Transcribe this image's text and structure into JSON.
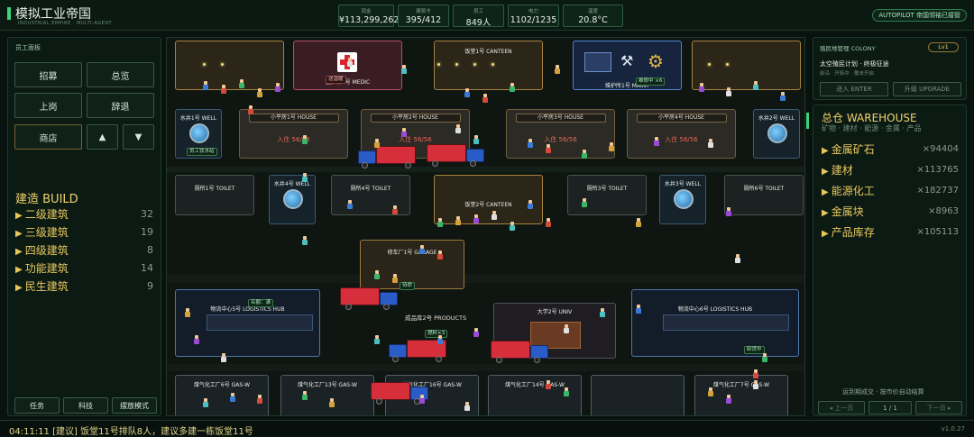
{
  "header": {
    "title": "模拟工业帝国",
    "subtitle": "INDUSTRIAL EMPIRE · MULTI-AGENT",
    "stats": [
      {
        "label": "现金",
        "value": "¥113,299,262"
      },
      {
        "label": "建筑令",
        "value": "395/412"
      },
      {
        "label": "员工",
        "value": "849人"
      },
      {
        "label": "电力",
        "value": "1102/1235"
      },
      {
        "label": "温度",
        "value": "20.8°C"
      }
    ],
    "autopilot": "AUTOPILOT 帝国领袖已接管"
  },
  "left": {
    "panel_title": "员工面板",
    "buttons": [
      "招募",
      "总览",
      "上岗",
      "辞退",
      "商店"
    ],
    "build_title": "建造 BUILD",
    "categories": [
      {
        "label": "二级建筑",
        "count": "32"
      },
      {
        "label": "三级建筑",
        "count": "19"
      },
      {
        "label": "四级建筑",
        "count": "8"
      },
      {
        "label": "功能建筑",
        "count": "14"
      },
      {
        "label": "民生建筑",
        "count": "9"
      }
    ],
    "bottom_buttons": [
      "任务",
      "科技",
      "摆放模式"
    ]
  },
  "right": {
    "colony_title": "殖民地管理 COLONY",
    "level": "Lv1",
    "plan": "太空殖民计划 · 终极征途",
    "plan_sub": "前沿 · 开拓中 · 敬未开启",
    "enter": "进入 ENTER",
    "upgrade": "升级 UPGRADE",
    "warehouse_title": "总仓 WAREHOUSE",
    "warehouse_sub": "矿物 · 建材 · 能源 · 金属 · 产品",
    "items": [
      {
        "label": "金属矿石",
        "count": "×94404"
      },
      {
        "label": "建材",
        "count": "×113765"
      },
      {
        "label": "能源化工",
        "count": "×182737"
      },
      {
        "label": "金属块",
        "count": "×8963"
      },
      {
        "label": "产品库存",
        "count": "×105113"
      }
    ],
    "auto_note": "运到期成交 · 按市价自动结算",
    "prev": "上一页",
    "page": "1 / 1",
    "next": "下一页"
  },
  "map": {
    "buildings": {
      "medic": "医护所1号 MEDIC",
      "canteen1": "饭堂1号 CANTEEN",
      "canteen2": "饭堂2号 CANTEEN",
      "maint": "维护所1号 MAINT",
      "house1": "小平房1号 HOUSE",
      "house2": "小平房2号 HOUSE",
      "house3": "小平房3号 HOUSE",
      "house4": "小平房4号 HOUSE",
      "house_status": "入住 56/56",
      "well1": "水井1号 WELL",
      "well2": "水井2号 WELL",
      "well3": "水井3号 WELL",
      "well4": "水井4号 WELL",
      "toilet1": "厕所1号 TOILET",
      "toilet3": "厕所3号 TOILET",
      "toilet4": "厕所4号 TOILET",
      "toilet6": "厕所6号 TOILET",
      "garage": "修车厂1号 GARAGE",
      "hub5": "物流中心5号 LOGISTICS HUB",
      "hub6": "物流中心6号 LOGISTICS HUB",
      "products": "成品库2号 PRODUCTS",
      "univ": "大学2号 UNIV",
      "gas6": "煤气化工厂6号 GAS-W",
      "gas13": "煤气化工厂13号 GAS-W",
      "gas16": "煤气化工厂16号 GAS-W",
      "gas14": "煤气化工厂14号 GAS-W",
      "gas7": "煤气化工厂7号 GAS-W"
    },
    "tags": {
      "medic_tag": "送温暖",
      "maint_tag": "维修中 ×6",
      "hub_tag": "名额：满",
      "fuel": "燃料×3",
      "tag_a": "员工饮水站",
      "tag_b": "待命",
      "tag_c": "卸货中"
    }
  },
  "footer": {
    "log": "04:11:11 [建议] 饭堂11号排队8人，建议多建一栋饭堂11号",
    "version": "v1.0.27"
  },
  "colors": {
    "accent": "#3ed27a",
    "gold": "#e8c85c",
    "truck_red": "#d62e3a",
    "truck_blue": "#2a5cc8"
  }
}
